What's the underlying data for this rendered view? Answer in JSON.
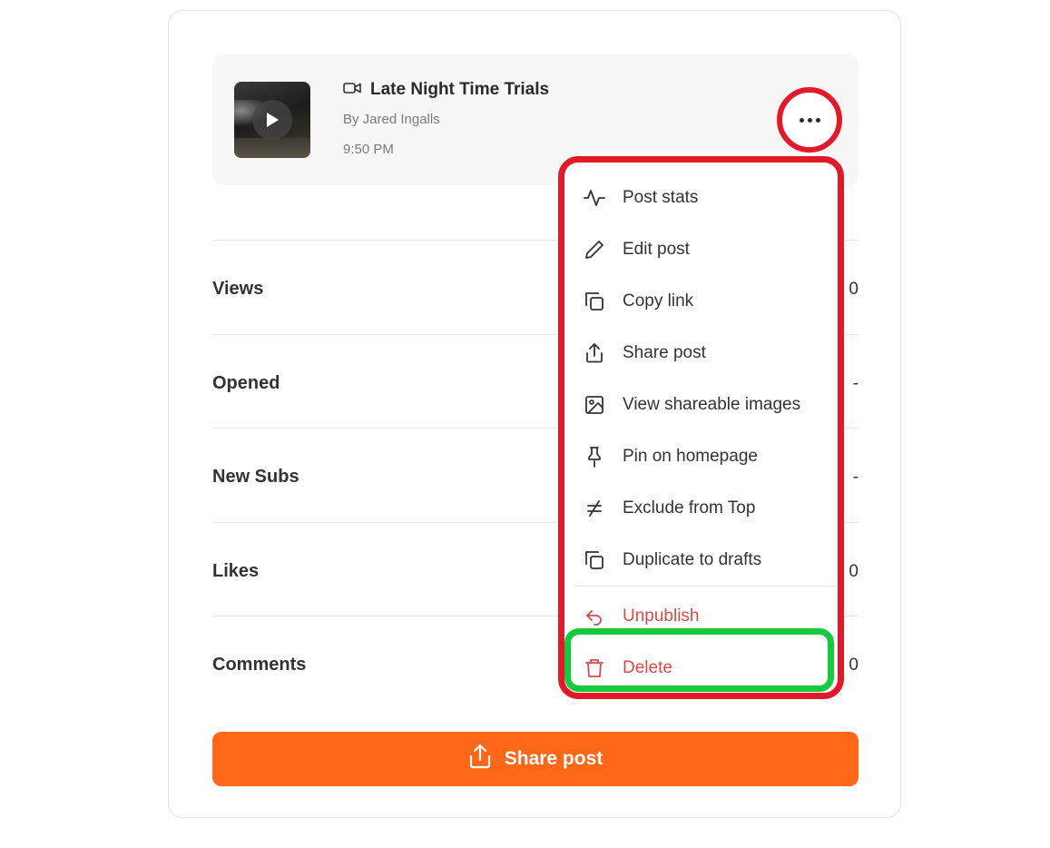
{
  "post": {
    "title": "Late Night Time Trials",
    "byline": "By Jared Ingalls",
    "time": "9:50 PM",
    "type_icon": "video-camera-icon"
  },
  "stats": [
    {
      "label": "Views",
      "value": "0"
    },
    {
      "label": "Opened",
      "value": "-"
    },
    {
      "label": "New Subs",
      "value": "-"
    },
    {
      "label": "Likes",
      "value": "0"
    },
    {
      "label": "Comments",
      "value": "0"
    }
  ],
  "share_button": {
    "label": "Share post",
    "icon": "upload-icon"
  },
  "menu": {
    "items": [
      {
        "label": "Post stats",
        "icon": "activity-icon"
      },
      {
        "label": "Edit post",
        "icon": "pencil-icon"
      },
      {
        "label": "Copy link",
        "icon": "copy-icon"
      },
      {
        "label": "Share post",
        "icon": "upload-icon"
      },
      {
        "label": "View shareable images",
        "icon": "image-icon"
      },
      {
        "label": "Pin on homepage",
        "icon": "pin-icon"
      },
      {
        "label": "Exclude from Top",
        "icon": "not-equal-icon"
      },
      {
        "label": "Duplicate to drafts",
        "icon": "duplicate-icon"
      },
      {
        "label": "Unpublish",
        "icon": "undo-icon"
      },
      {
        "label": "Delete",
        "icon": "trash-icon"
      }
    ]
  },
  "colors": {
    "accent": "#ff6719",
    "danger": "#d64b4b",
    "highlight_red": "#e11a2a",
    "highlight_green": "#18c93e"
  }
}
